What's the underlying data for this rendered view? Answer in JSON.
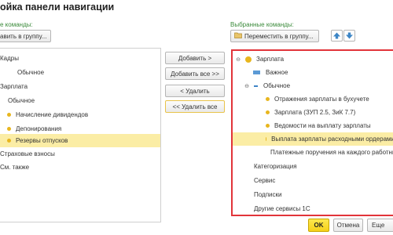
{
  "title": "ойка панели навигации",
  "left": {
    "header": "е команды:",
    "add_group_label": "авить в группу...",
    "items": [
      {
        "label": "Кадры"
      },
      {
        "label": "Обычное"
      },
      {
        "label": "Зарплата"
      },
      {
        "label": "Обычное"
      },
      {
        "label": "Начисление дивидендов"
      },
      {
        "label": "Депонирования"
      },
      {
        "label": "Резервы отпусков"
      },
      {
        "label": "Страховые взносы"
      },
      {
        "label": "См. также"
      }
    ]
  },
  "middle": {
    "add": "Добавить >",
    "add_all": "Добавить все >>",
    "remove": "< Удалить",
    "remove_all": "<< Удалить все"
  },
  "right": {
    "header": "Выбранные команды:",
    "move_group_label": "Переместить в группу...",
    "items": [
      {
        "label": "Зарплата"
      },
      {
        "label": "Важное"
      },
      {
        "label": "Обычное"
      },
      {
        "label": "Отражения зарплаты в бухучете"
      },
      {
        "label": "Зарплата (ЗУП 2.5, ЗиК 7.7)"
      },
      {
        "label": "Ведомости на выплату зарплаты"
      },
      {
        "label": "Выплата зарплаты расходными ордерами"
      },
      {
        "label": "Платежные поручения на каждого работника"
      },
      {
        "label": "Категоризация"
      },
      {
        "label": "Сервис"
      },
      {
        "label": "Подписки"
      },
      {
        "label": "Другие сервисы 1С"
      }
    ]
  },
  "footer": {
    "ok": "OK",
    "cancel": "Отмена",
    "more": "Еще"
  },
  "colors": {
    "accent_green": "#3a8a3a",
    "selection": "#fbeda5",
    "highlight_border": "#e2343a",
    "ok_yellow": "#f6d11a",
    "bullet": "#e8b61e"
  }
}
